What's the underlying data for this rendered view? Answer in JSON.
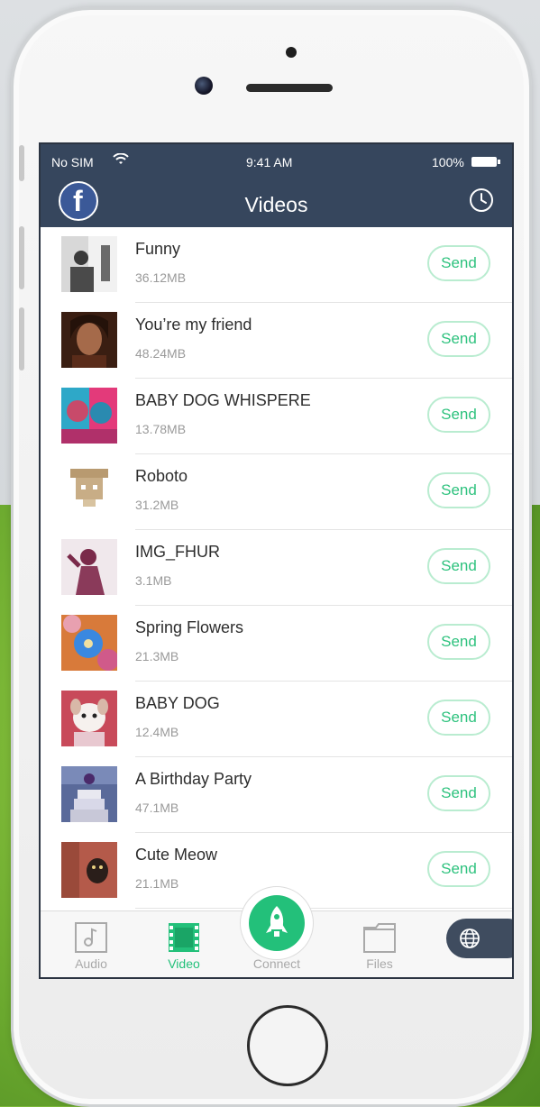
{
  "status_bar": {
    "carrier": "No SIM",
    "time": "9:41 AM",
    "battery": "100%"
  },
  "header": {
    "title": "Videos"
  },
  "videos": [
    {
      "name": "Funny",
      "size": "36.12MB",
      "send": "Send"
    },
    {
      "name": "You’re my friend",
      "size": "48.24MB",
      "send": "Send"
    },
    {
      "name": "BABY DOG WHISPERE",
      "size": "13.78MB",
      "send": "Send"
    },
    {
      "name": "Roboto",
      "size": "31.2MB",
      "send": "Send"
    },
    {
      "name": "IMG_FHUR",
      "size": "3.1MB",
      "send": "Send"
    },
    {
      "name": "Spring Flowers",
      "size": "21.3MB",
      "send": "Send"
    },
    {
      "name": "BABY DOG",
      "size": "12.4MB",
      "send": "Send"
    },
    {
      "name": "A Birthday  Party",
      "size": "47.1MB",
      "send": "Send"
    },
    {
      "name": "Cute Meow",
      "size": "21.1MB",
      "send": "Send"
    }
  ],
  "tabs": [
    {
      "label": "Audio",
      "icon": "music-note-icon"
    },
    {
      "label": "Video",
      "icon": "film-icon",
      "active": true
    },
    {
      "label": "Connect",
      "icon": "rocket-icon"
    },
    {
      "label": "Files",
      "icon": "folder-icon"
    }
  ],
  "colors": {
    "accent": "#23c07a",
    "navbar": "#36465d",
    "tab_inactive": "#a9a9a9"
  }
}
